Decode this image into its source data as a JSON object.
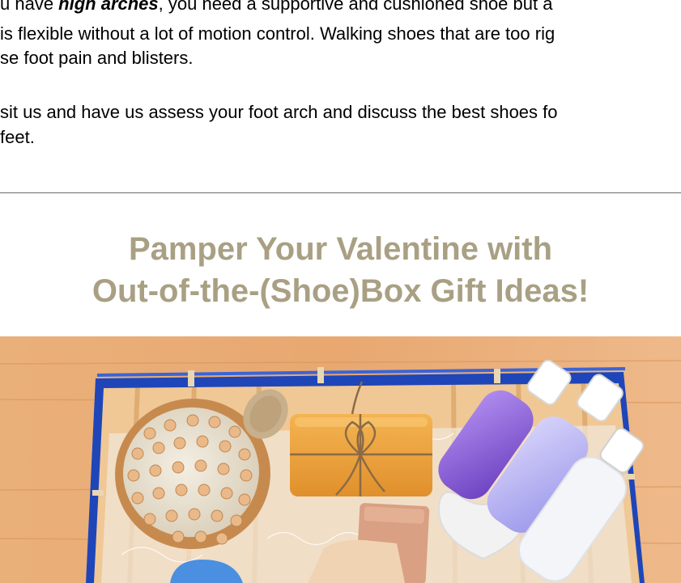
{
  "article": {
    "line1_prefix": "u have ",
    "line1_emphasis": "high arches",
    "line1_suffix": ", you need a supportive and cushioned shoe but a",
    "line2": "is flexible without a lot of motion control. Walking shoes that are too rig",
    "line3": "se foot pain and blisters.",
    "line4": "sit us and have us assess your foot arch and discuss the best shoes fo",
    "line5": " feet."
  },
  "section": {
    "heading_line1": "Pamper Your Valentine with",
    "heading_line2": "Out-of-the-(Shoe)Box Gift Ideas!"
  },
  "colors": {
    "heading": "#a9a084",
    "divider": "#6a6a6a",
    "wood": "#e7a86f",
    "basket_rim": "#1f46b8"
  },
  "image": {
    "subject": "gift basket with bath and spa products"
  }
}
